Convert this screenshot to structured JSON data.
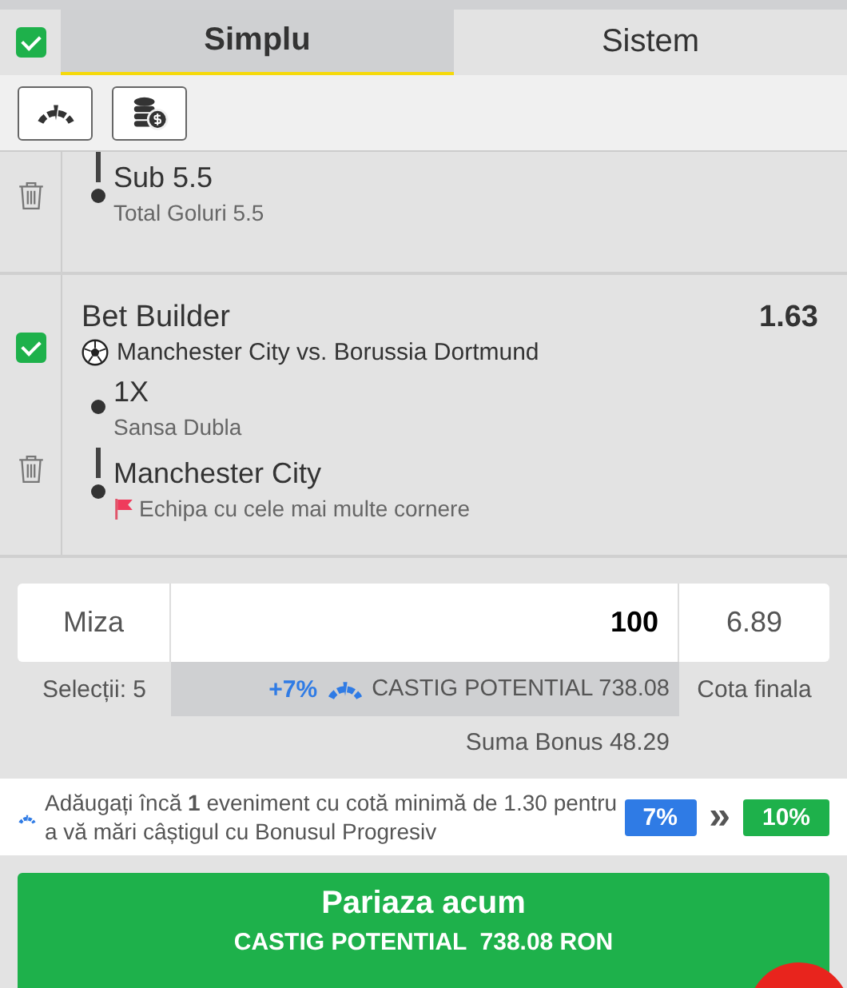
{
  "header": {
    "select_all_checked": true
  },
  "tabs": [
    {
      "label": "Simplu",
      "selected": true
    },
    {
      "label": "Sistem",
      "selected": false
    }
  ],
  "toolbar": {
    "buttons": [
      {
        "kind": "gauge"
      },
      {
        "kind": "coins"
      }
    ]
  },
  "groups": [
    {
      "cut_off": true,
      "legs": [
        {
          "title": "Sub 5.5",
          "market": "Total Goluri 5.5",
          "kind": "plain"
        }
      ]
    },
    {
      "cut_off": false,
      "checked": true,
      "title": "Bet Builder",
      "odds": "1.63",
      "match": "Manchester City vs. Borussia Dortmund",
      "legs": [
        {
          "title": "1X",
          "market": "Sansa Dubla",
          "kind": "plain"
        },
        {
          "title": "Manchester City",
          "market": "Echipa cu cele mai multe cornere",
          "kind": "flagged"
        }
      ]
    }
  ],
  "stake": {
    "label": "Miza",
    "value": "100",
    "total_odds": "6.89",
    "selections_count": "Selecții: 5",
    "boost": "+7%",
    "potential_win": "CASTIG POTENTIAL 738.08",
    "odds_label": "Cota finala",
    "bonus": "Suma Bonus 48.29"
  },
  "info": {
    "message": "Adăugați încă **1** eveniment cu cotă minimă de 1.30 pentru a vă mări câștigul cu Bonusul Progresiv",
    "current": "7%",
    "arrow": "»",
    "next": "10%"
  },
  "place_bet": {
    "label": "Pariaza acum",
    "sublabel": "CASTIG POTENTIAL  738.08 RON"
  }
}
